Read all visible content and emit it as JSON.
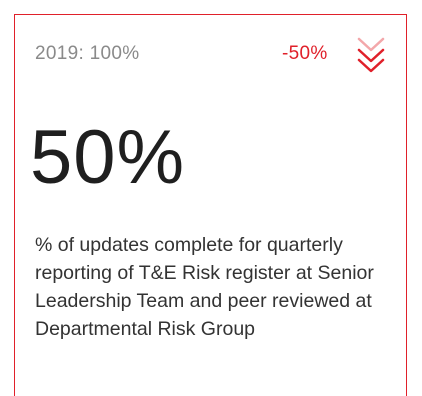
{
  "card": {
    "baseline_label": "2019: 100%",
    "delta_label": "-50%",
    "trend_icon": "double-chevron-down-icon",
    "value": "50%",
    "description": "% of updates complete for quarterly reporting of T&E Risk register at Senior Leadership Team and peer reviewed at Departmental Risk Group"
  },
  "colors": {
    "accent": "#e0202a",
    "accent_light": "#f3a7aa",
    "muted_text": "#8a8a8a",
    "value_text": "#1f1f1f"
  }
}
